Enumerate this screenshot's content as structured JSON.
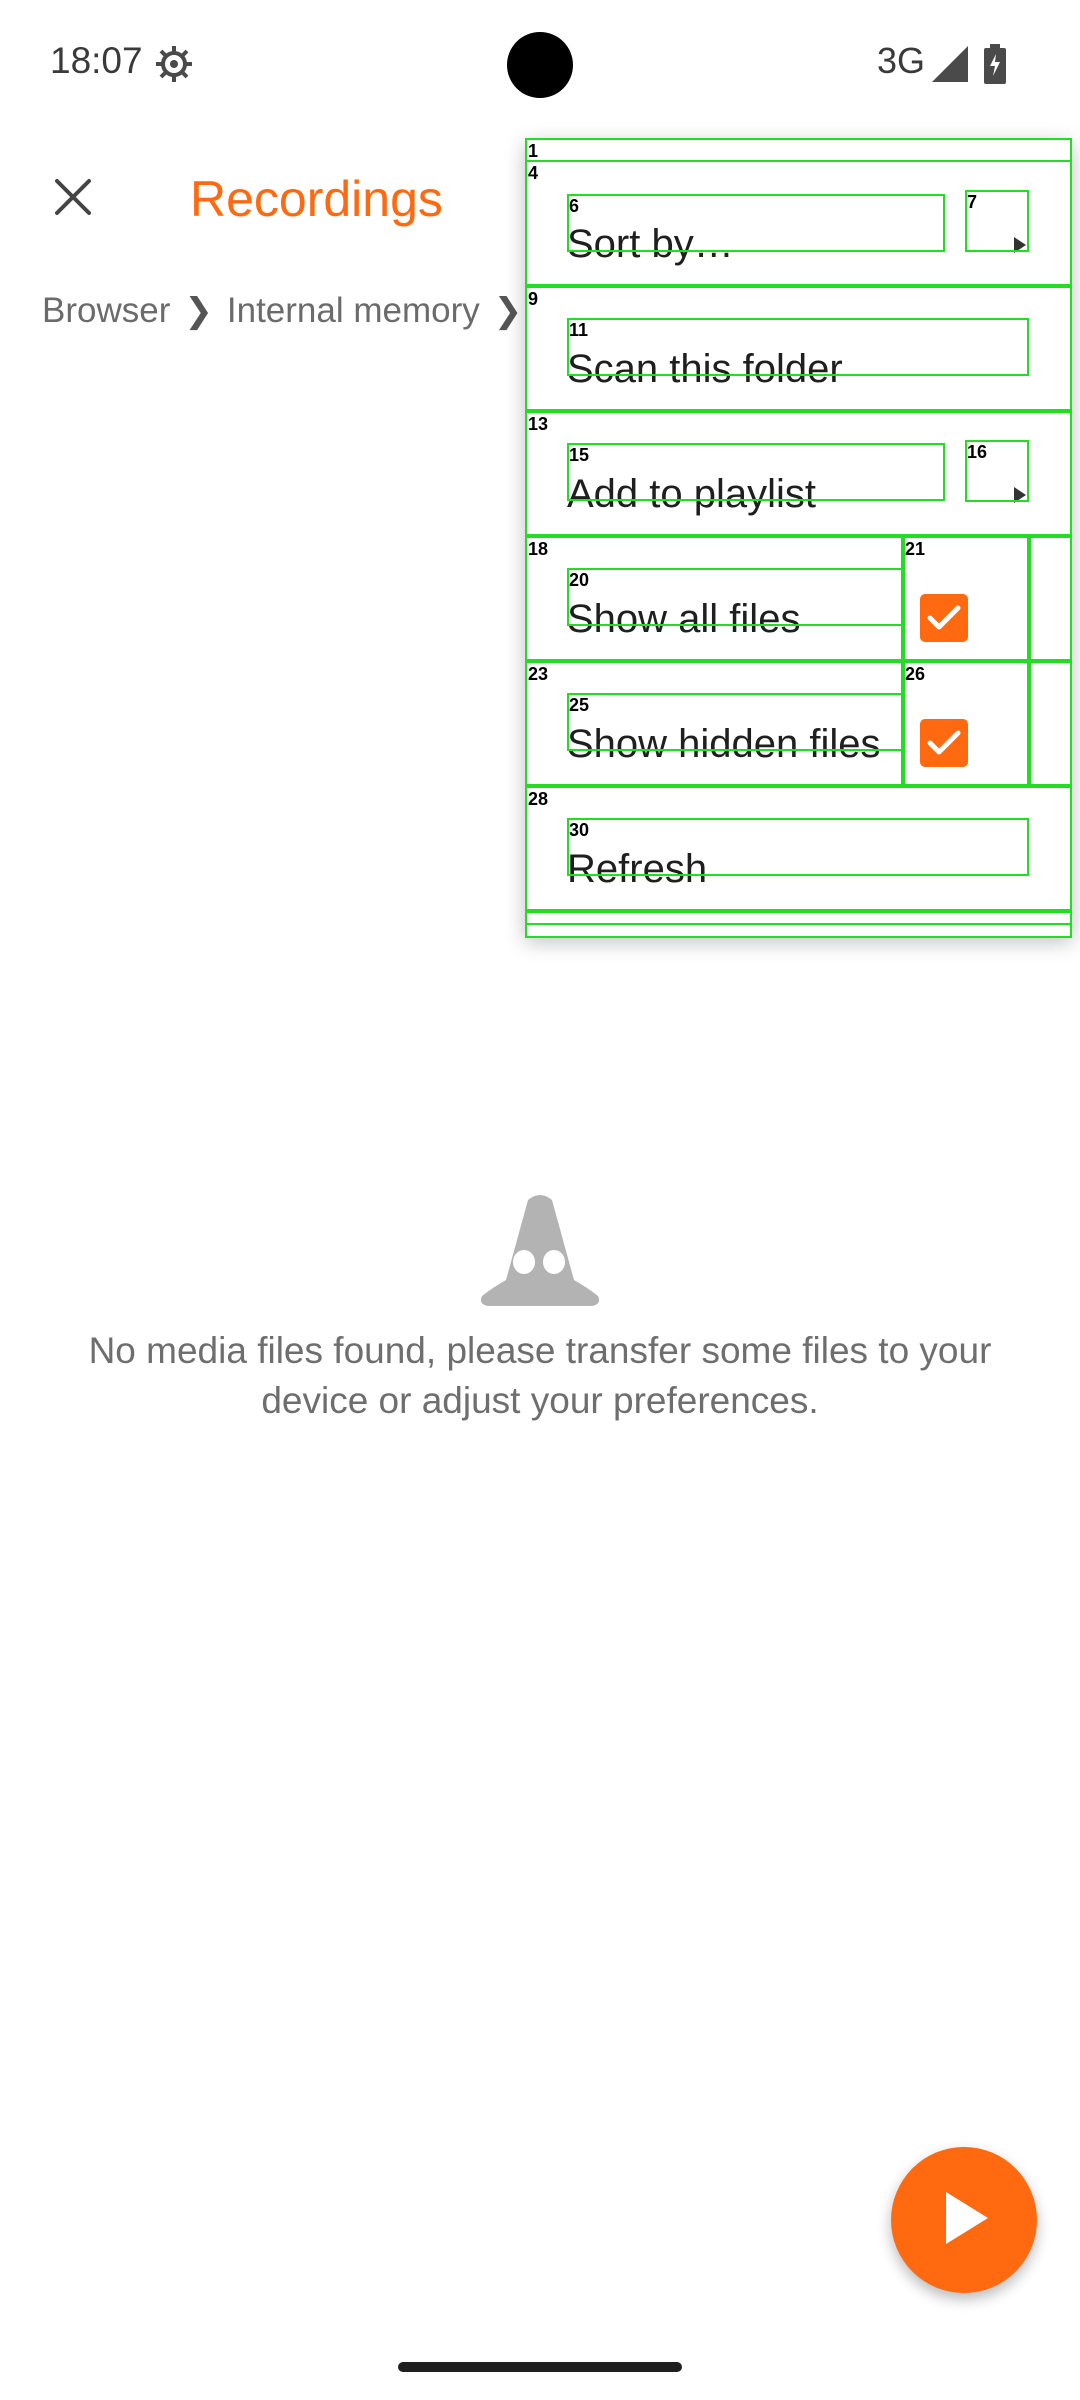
{
  "status_bar": {
    "time": "18:07",
    "network": "3G",
    "icons": [
      "settings-gear-icon",
      "signal-icon",
      "battery-icon"
    ]
  },
  "toolbar": {
    "title": "Recordings",
    "close_icon": "close-icon"
  },
  "breadcrumb": {
    "items": [
      "Browser",
      "Internal memory"
    ],
    "separator": "❯"
  },
  "empty_state": {
    "message": "No media files found, please transfer some files to your device or adjust your preferences.",
    "icon": "cone-icon"
  },
  "fab": {
    "icon": "play-icon"
  },
  "menu": {
    "items": [
      {
        "label": "Sort by…",
        "has_submenu": true
      },
      {
        "label": "Scan this folder"
      },
      {
        "label": "Add to playlist",
        "has_submenu": true
      },
      {
        "label": "Show all files",
        "checked": true
      },
      {
        "label": "Show hidden files",
        "checked": true
      },
      {
        "label": "Refresh"
      }
    ]
  },
  "overlay_numbers": [
    "1",
    "4",
    "6",
    "7",
    "9",
    "11",
    "13",
    "15",
    "16",
    "18",
    "20",
    "21",
    "23",
    "25",
    "26",
    "28",
    "30"
  ],
  "colors": {
    "accent": "#ff6a10",
    "overlay": "#22dd22"
  }
}
